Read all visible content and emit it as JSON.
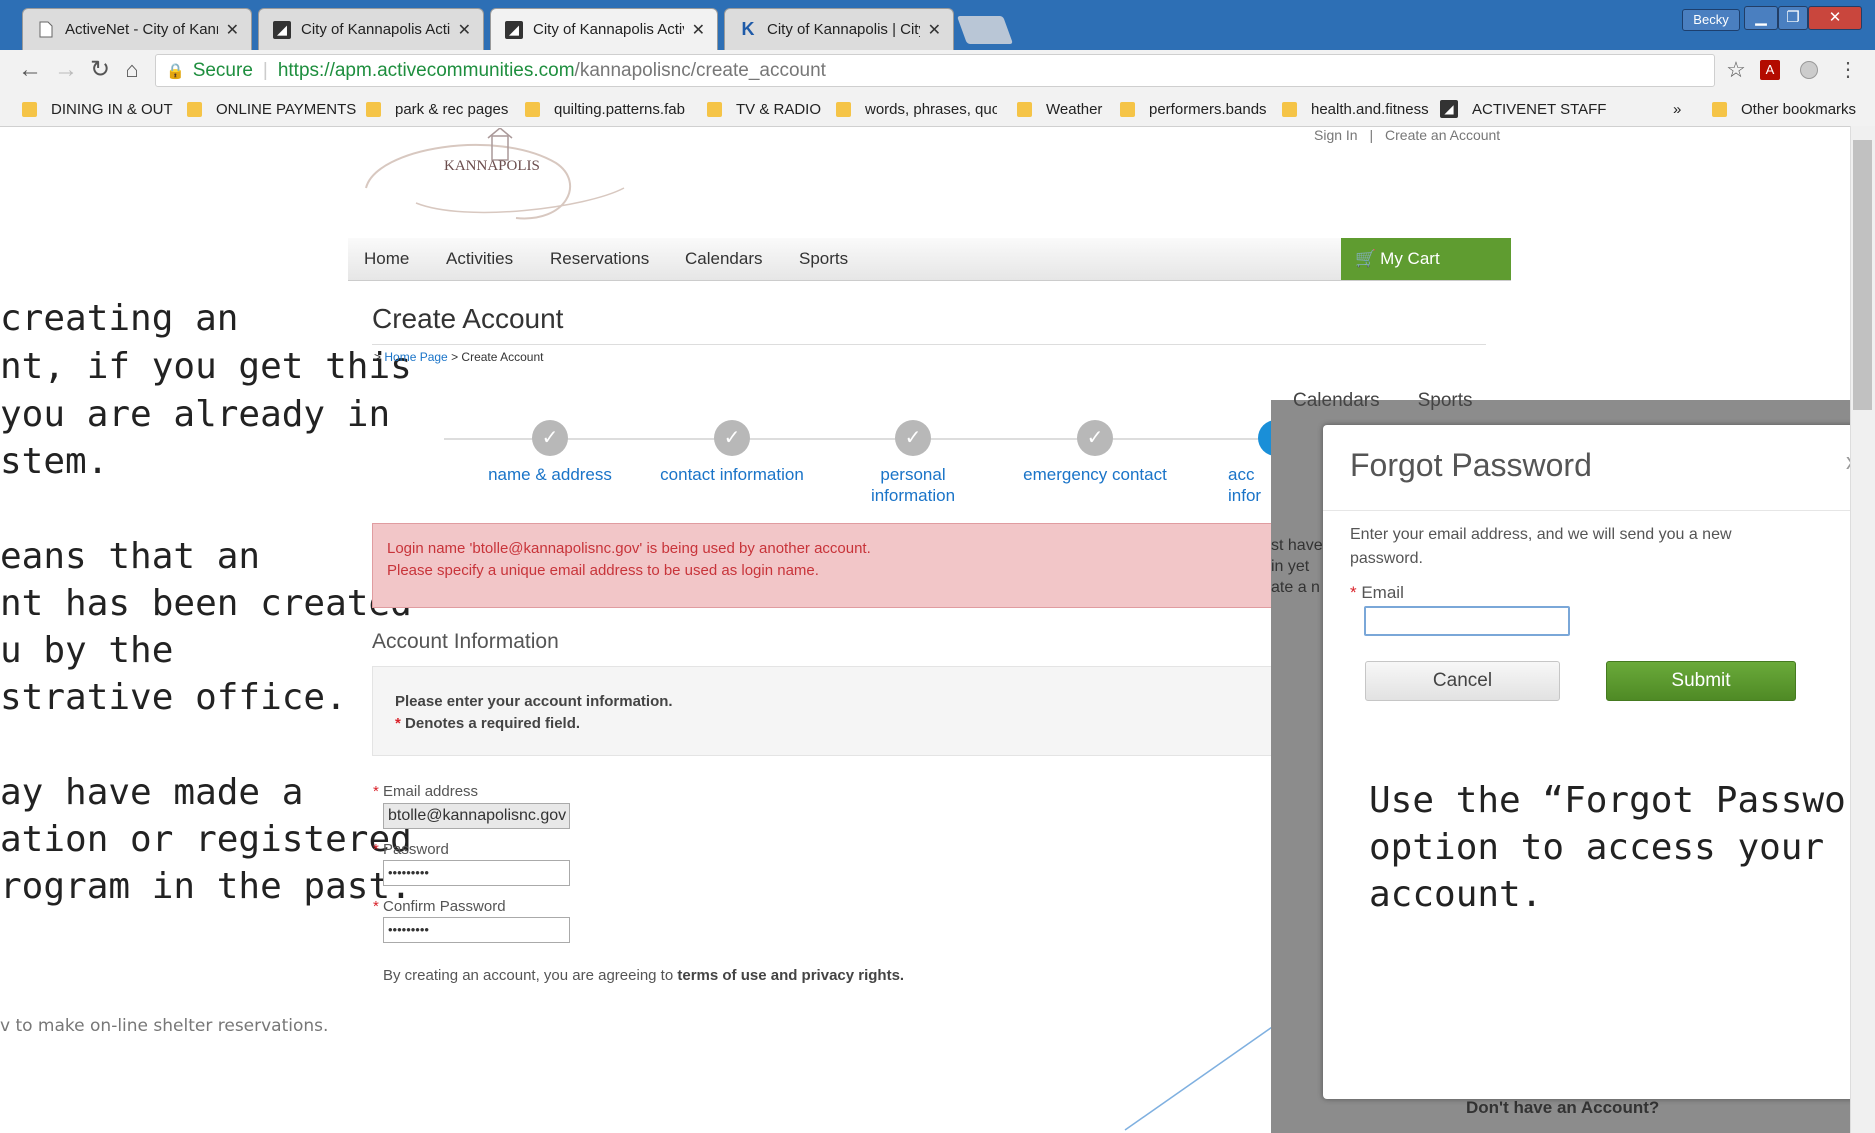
{
  "tabs": [
    {
      "title": "ActiveNet - City of Kanna",
      "active": false,
      "icon": "page-icon"
    },
    {
      "title": "City of Kannapolis Activit",
      "active": false,
      "icon": "activenet-icon"
    },
    {
      "title": "City of Kannapolis Activit",
      "active": true,
      "icon": "activenet-icon"
    },
    {
      "title": "City of Kannapolis | City o",
      "active": false,
      "icon": "kannapolis-k-icon"
    }
  ],
  "window": {
    "user": "Becky"
  },
  "address": {
    "secure": "Secure",
    "domain": "https://apm.activecommunities.com",
    "path": "/kannapolisnc/create_account"
  },
  "bookmarks": [
    "DINING IN & OUT",
    "ONLINE PAYMENTS",
    "park & rec pages",
    "quilting.patterns.fab",
    "TV & RADIO",
    "words, phrases, quot",
    "Weather",
    "performers.bands",
    "health.and.fitness",
    "ACTIVENET STAFF"
  ],
  "bookmarks_more": "»",
  "bookmarks_other": "Other bookmarks",
  "slide_left": {
    "lines": [
      "creating an",
      "nt, if you get this",
      "you are already in",
      "stem.",
      "eans that an",
      "nt has been created",
      "u by the",
      "strative office.",
      "ay have made a",
      "ation or registered",
      "rogram in the past."
    ],
    "footer": "v to make on-line shelter reservations."
  },
  "site": {
    "logo": "KANNAPOLIS",
    "signin": "Sign In",
    "separator": "|",
    "create_account": "Create an Account",
    "nav": [
      "Home",
      "Activities",
      "Reservations",
      "Calendars",
      "Sports"
    ],
    "cart": "My Cart",
    "page_title": "Create Account",
    "breadcrumb_prefix": ">",
    "breadcrumb_home": "Home Page",
    "breadcrumb_current": "> Create Account",
    "steps": [
      "name & address",
      "contact information",
      "personal\ninformation",
      "emergency contact",
      "acc\ninfor"
    ],
    "error_line1": "Login name 'btolle@kannapolisnc.gov' is being used by another account.",
    "error_line2": "Please specify a unique email address to be used as login name.",
    "section_title": "Account Information",
    "info_line1": "Please enter your account information.",
    "info_line2": "Denotes a required field.",
    "email_label": "Email address",
    "email_value": "btolle@kannapolisnc.gov",
    "password_label": "Password",
    "password_value": "•••••••••",
    "confirm_label": "Confirm Password",
    "confirm_value": "•••••••••",
    "terms_prefix": "By creating an account, you are agreeing to",
    "terms_link": "terms of use and privacy rights."
  },
  "overlay": {
    "bg_nav": [
      "Calendars",
      "Sports"
    ],
    "bg_text": [
      "st have",
      "in yet",
      "ate a n"
    ],
    "bottom_text": "Don't have an Account?"
  },
  "modal": {
    "title": "Forgot Password",
    "close": "x",
    "instruction": "Enter your email address, and we will send you a new password.",
    "email_label": "Email",
    "cancel": "Cancel",
    "submit": "Submit",
    "callout": [
      "Use the “Forgot Password”",
      "option to access your",
      "account."
    ]
  }
}
